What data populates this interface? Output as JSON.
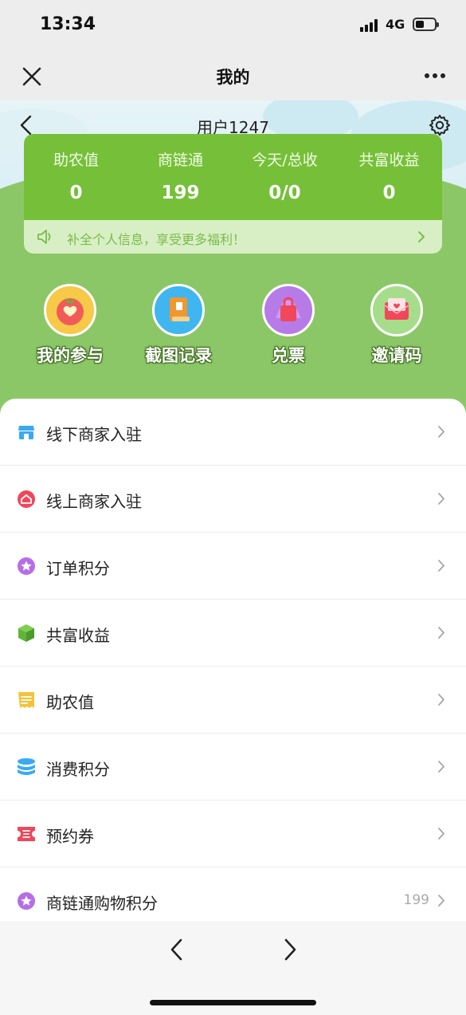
{
  "status": {
    "time": "13:34",
    "network": "4G",
    "battery_level": 0.45
  },
  "nav": {
    "title": "我的"
  },
  "profile": {
    "username": "用户1247"
  },
  "stats": [
    {
      "label": "助农值",
      "value": "0"
    },
    {
      "label": "商链通",
      "value": "199"
    },
    {
      "label": "今天/总收",
      "value": "0/0"
    },
    {
      "label": "共富收益",
      "value": "0"
    }
  ],
  "notice": {
    "text": "补全个人信息，享受更多福利！"
  },
  "quick_actions": [
    {
      "label": "我的参与",
      "icon": "heart-fruit-icon",
      "color": "#f7c948"
    },
    {
      "label": "截图记录",
      "icon": "book-icon",
      "color": "#3fb6f0"
    },
    {
      "label": "兑票",
      "icon": "bag-icon",
      "color": "#b77be8"
    },
    {
      "label": "邀请码",
      "icon": "envelope-icon",
      "color": "#a6dd8a"
    }
  ],
  "menu": [
    {
      "label": "线下商家入驻",
      "icon": "store-icon",
      "color": "#3aa9f4",
      "value": ""
    },
    {
      "label": "线上商家入驻",
      "icon": "home-icon",
      "color": "#f0475a",
      "value": ""
    },
    {
      "label": "订单积分",
      "icon": "star-icon",
      "color": "#b66ee6",
      "value": ""
    },
    {
      "label": "共富收益",
      "icon": "cube-icon",
      "color": "#5fb43c",
      "value": ""
    },
    {
      "label": "助农值",
      "icon": "receipt-icon",
      "color": "#f4c23a",
      "value": ""
    },
    {
      "label": "消费积分",
      "icon": "coins-icon",
      "color": "#3aa9f4",
      "value": ""
    },
    {
      "label": "预约券",
      "icon": "ticket-icon",
      "color": "#f0475a",
      "value": ""
    },
    {
      "label": "商链通购物积分",
      "icon": "star-icon",
      "color": "#b66ee6",
      "value": "199"
    }
  ]
}
